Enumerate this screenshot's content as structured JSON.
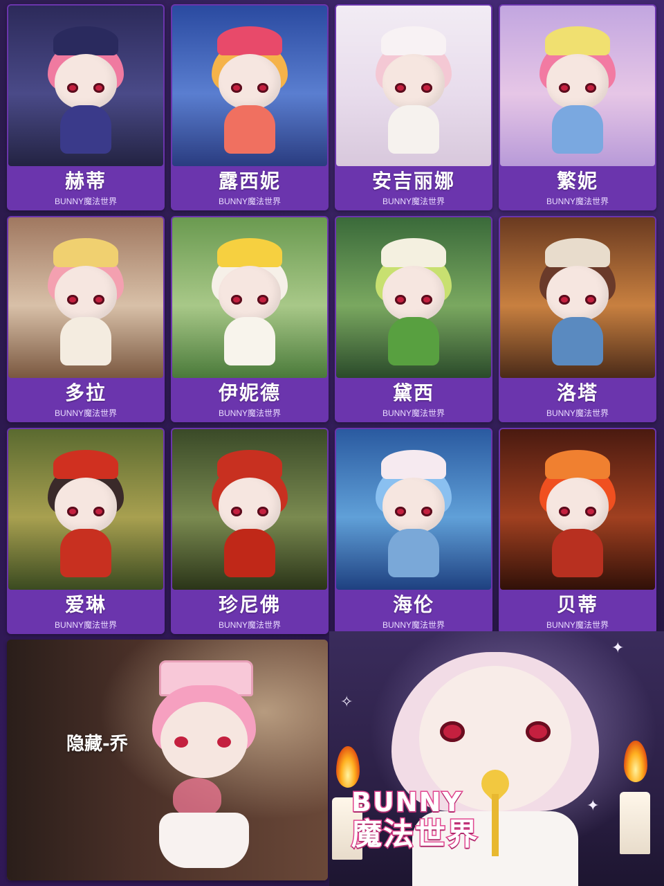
{
  "series_label": "BUNNY魔法世界",
  "cards": [
    {
      "name": "赫蒂",
      "bg": [
        "#2c2a5a",
        "#4a4a88",
        "#232342"
      ],
      "hair": "#f07aa0",
      "hat": "#2a2a5e",
      "body": "#3a3a8a"
    },
    {
      "name": "露西妮",
      "bg": [
        "#2a4aa0",
        "#5a7ed0",
        "#2a3c80"
      ],
      "hair": "#f5b34a",
      "hat": "#e84a6a",
      "body": "#f07060"
    },
    {
      "name": "安吉丽娜",
      "bg": [
        "#f2ecf4",
        "#e8dcec",
        "#d8c8dc"
      ],
      "hair": "#f4c8d4",
      "hat": "#f8f2f4",
      "body": "#f6f2ee"
    },
    {
      "name": "繁妮",
      "bg": [
        "#c2a6e0",
        "#e6c6e6",
        "#b89ad8"
      ],
      "hair": "#f27aa2",
      "hat": "#f0e070",
      "body": "#7aa8e0"
    },
    {
      "name": "多拉",
      "bg": [
        "#a07860",
        "#d8c0a8",
        "#7a5840"
      ],
      "hair": "#f4a0b0",
      "hat": "#f0d070",
      "body": "#f4ece0"
    },
    {
      "name": "伊妮德",
      "bg": [
        "#6a9a50",
        "#a8c888",
        "#4a7a3a"
      ],
      "hair": "#f6f0e8",
      "hat": "#f6d040",
      "body": "#f8f4ec"
    },
    {
      "name": "黛西",
      "bg": [
        "#3a6a3a",
        "#7aa860",
        "#2a4a2a"
      ],
      "hair": "#c8e070",
      "hat": "#f4f0e0",
      "body": "#58a040"
    },
    {
      "name": "洛塔",
      "bg": [
        "#6a3a20",
        "#c88040",
        "#4a2a18"
      ],
      "hair": "#6a3a2a",
      "hat": "#e8dccc",
      "body": "#5a8ac0"
    },
    {
      "name": "爱琳",
      "bg": [
        "#5a6a30",
        "#a8a050",
        "#3a4a20"
      ],
      "hair": "#3a2a2a",
      "hat": "#d03020",
      "body": "#c83020"
    },
    {
      "name": "珍尼佛",
      "bg": [
        "#3a4a28",
        "#7a8a50",
        "#2a3418"
      ],
      "hair": "#c83020",
      "hat": "#c83020",
      "body": "#c02818"
    },
    {
      "name": "海伦",
      "bg": [
        "#2a5aa0",
        "#60a0d8",
        "#1e4080"
      ],
      "hair": "#8ac0f0",
      "hat": "#f6eaf0",
      "body": "#7aa8d8"
    },
    {
      "name": "贝蒂",
      "bg": [
        "#4a1a10",
        "#a04020",
        "#301008"
      ],
      "hair": "#f05020",
      "hat": "#f08030",
      "body": "#b83020"
    }
  ],
  "hidden": {
    "label": "隐藏-乔"
  },
  "banner": {
    "title_en": "BUNNY",
    "title_zh": "魔法世界"
  }
}
